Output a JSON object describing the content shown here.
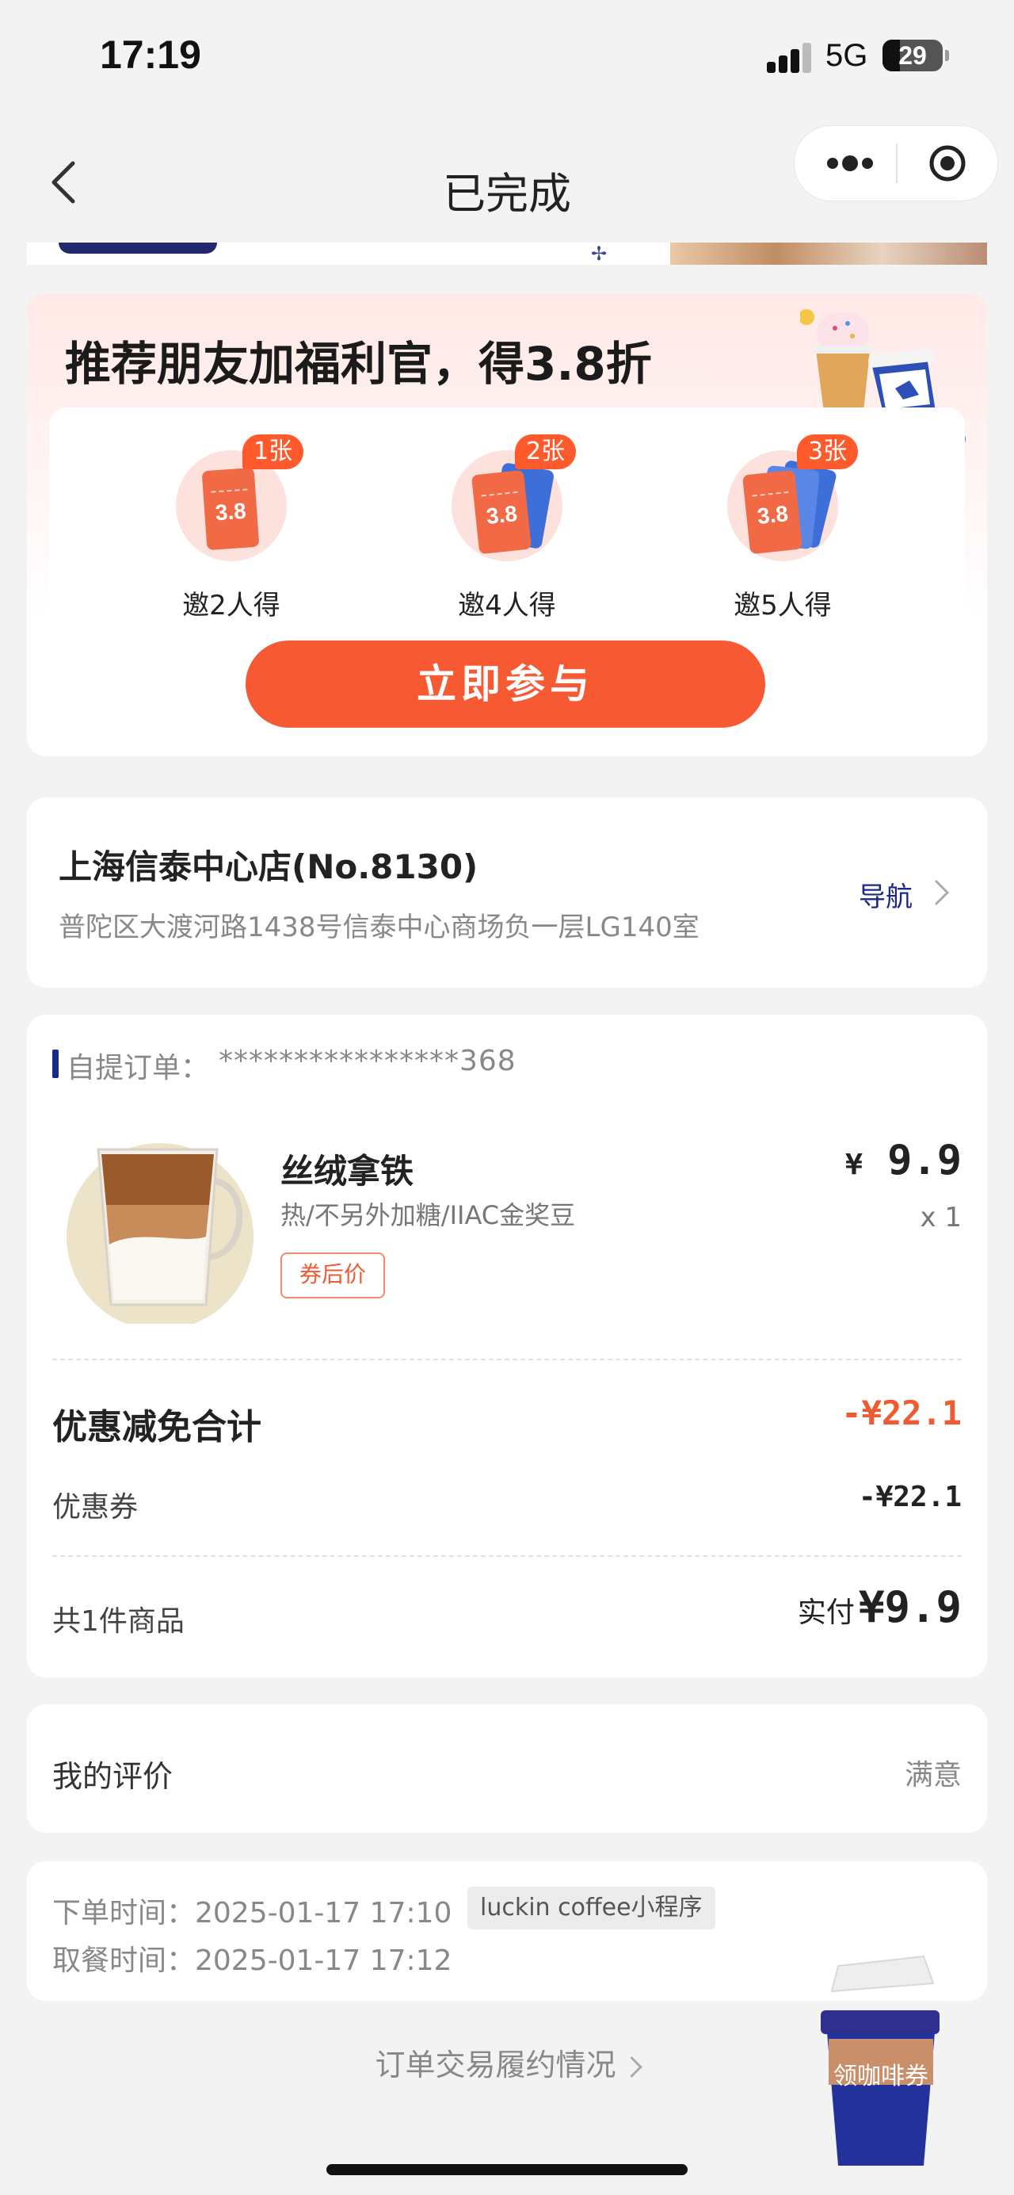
{
  "status_bar": {
    "time": "17:19",
    "network": "5G",
    "battery": "29"
  },
  "nav": {
    "title": "已完成"
  },
  "promo": {
    "title": "推荐朋友加福利官，得3.8折",
    "rewards": [
      {
        "badge": "1张",
        "ticket": "3.8",
        "label": "邀2人得"
      },
      {
        "badge": "2张",
        "ticket": "3.8",
        "label": "邀4人得"
      },
      {
        "badge": "3张",
        "ticket": "3.8",
        "label": "邀5人得"
      }
    ],
    "join_label": "立即参与"
  },
  "store": {
    "name": "上海信泰中心店(No.8130)",
    "address": "普陀区大渡河路1438号信泰中心商场负一层LG140室",
    "nav_label": "导航"
  },
  "order": {
    "label": "自提订单：",
    "number": "****************368",
    "product": {
      "name": "丝绒拿铁",
      "spec": "热/不另外加糖/IIAC金奖豆",
      "tag": "券后价",
      "currency": "¥",
      "price": "9.9",
      "qty": "x 1"
    },
    "discount": {
      "title": "优惠减免合计",
      "total": "-¥22.1",
      "coupon_label": "优惠券",
      "coupon_amount": "-¥22.1"
    },
    "summary": {
      "count": "共1件商品",
      "paid_label": "实付",
      "paid_amount": "¥9.9"
    }
  },
  "review": {
    "label": "我的评价",
    "value": "满意"
  },
  "times": {
    "order_time": "下单时间：2025-01-17 17:10",
    "channel": "luckin coffee小程序",
    "pickup_time": "取餐时间：2025-01-17 17:12"
  },
  "fulfilment_link": "订单交易履约情况",
  "float_button": "领咖啡券",
  "colors": {
    "brand_blue": "#1b2a86",
    "accent_orange": "#f75a32",
    "discount_red": "#ee5b32"
  }
}
